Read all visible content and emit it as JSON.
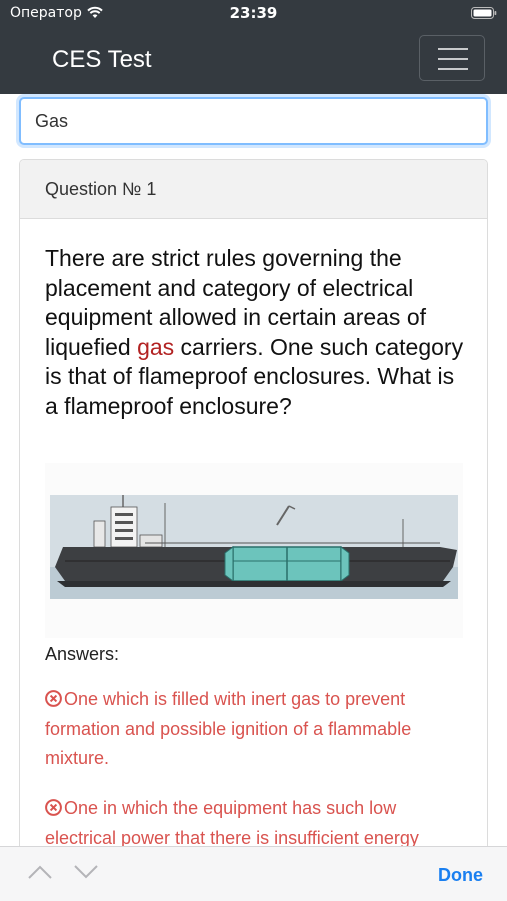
{
  "status_bar": {
    "carrier": "Оператор",
    "time": "23:39",
    "icons": [
      "wifi-icon",
      "battery-icon"
    ]
  },
  "navbar": {
    "title": "CES Test",
    "menu_icon": "hamburger-icon"
  },
  "search": {
    "value": "Gas",
    "placeholder": ""
  },
  "question": {
    "header": "Question № 1",
    "text_before": "There are strict rules governing the placement and category of electrical equipment allowed in certain areas of liquefied ",
    "highlight": "gas",
    "text_after": " carriers. One such category is that of flameproof enclosures. What is a flameproof enclosure?",
    "image": "liquefied-gas-carrier-ship-diagram",
    "answers_label": "Answers:",
    "answers": [
      {
        "icon": "wrong-answer-icon",
        "text": "One which is filled with inert gas to prevent formation and possible ignition of a flammable mixture."
      },
      {
        "icon": "wrong-answer-icon",
        "text": "One in which the equipment has such low electrical power that there is insufficient energy"
      }
    ]
  },
  "keyboard_toolbar": {
    "previous_icon": "chevron-up-icon",
    "next_icon": "chevron-down-icon",
    "done_label": "Done"
  },
  "colors": {
    "navbar_bg": "#343a40",
    "highlight": "#b22222",
    "wrong_answer": "#d9534f",
    "focus_border": "#80bdff",
    "done": "#1a7ff0"
  }
}
